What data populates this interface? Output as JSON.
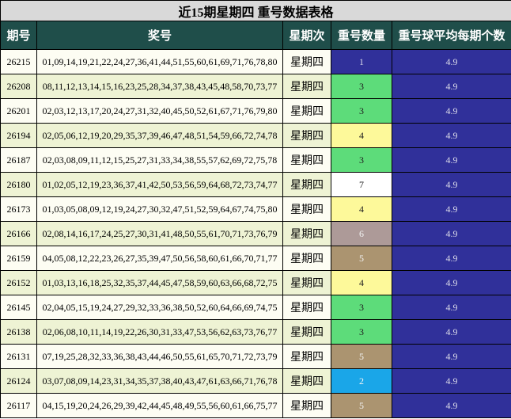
{
  "title": "近15期星期四 重号数据表格",
  "headers": [
    "期号",
    "奖号",
    "星期次",
    "重号数量",
    "重号球平均每期个数"
  ],
  "rows": [
    {
      "id": "26215",
      "numbers": "01,09,14,19,21,22,24,27,36,41,44,51,55,60,61,69,71,76,78,80",
      "week": "星期四",
      "count": "1",
      "count_color": "#30309a",
      "count_text_color": "#d8d8e8",
      "avg": "4.9"
    },
    {
      "id": "26208",
      "numbers": "08,11,12,13,14,15,16,23,25,28,34,37,38,43,45,48,58,70,73,77",
      "week": "星期四",
      "count": "3",
      "count_color": "#5ddc7a",
      "count_text_color": "#222222",
      "avg": "4.9"
    },
    {
      "id": "26201",
      "numbers": "02,03,12,13,17,20,24,27,31,32,40,45,50,52,61,67,71,76,79,80",
      "week": "星期四",
      "count": "3",
      "count_color": "#5ddc7a",
      "count_text_color": "#222222",
      "avg": "4.9"
    },
    {
      "id": "26194",
      "numbers": "02,05,06,12,19,20,29,35,37,39,46,47,48,51,54,59,66,72,74,78",
      "week": "星期四",
      "count": "4",
      "count_color": "#fdf99a",
      "count_text_color": "#222222",
      "avg": "4.9"
    },
    {
      "id": "26187",
      "numbers": "02,03,08,09,11,12,15,25,27,31,33,34,38,55,57,62,69,72,75,78",
      "week": "星期四",
      "count": "3",
      "count_color": "#5ddc7a",
      "count_text_color": "#222222",
      "avg": "4.9"
    },
    {
      "id": "26180",
      "numbers": "01,02,05,12,19,23,36,37,41,42,50,53,56,59,64,68,72,73,74,77",
      "week": "星期四",
      "count": "7",
      "count_color": "#ffffff",
      "count_text_color": "#222222",
      "avg": "4.9"
    },
    {
      "id": "26173",
      "numbers": "01,03,05,08,09,12,19,24,27,30,32,47,51,52,59,64,67,74,75,80",
      "week": "星期四",
      "count": "4",
      "count_color": "#fdf99a",
      "count_text_color": "#222222",
      "avg": "4.9"
    },
    {
      "id": "26166",
      "numbers": "02,08,14,16,17,24,25,27,30,31,41,48,50,55,61,70,71,73,76,79",
      "week": "星期四",
      "count": "6",
      "count_color": "#ad9a98",
      "count_text_color": "#f2f2f2",
      "avg": "4.9"
    },
    {
      "id": "26159",
      "numbers": "04,05,08,12,22,23,26,27,35,39,47,50,56,58,60,61,66,70,71,77",
      "week": "星期四",
      "count": "5",
      "count_color": "#ab9470",
      "count_text_color": "#f2f2f2",
      "avg": "4.9"
    },
    {
      "id": "26152",
      "numbers": "01,03,13,16,18,25,32,35,37,44,45,47,58,59,60,63,66,68,72,75",
      "week": "星期四",
      "count": "4",
      "count_color": "#fdf99a",
      "count_text_color": "#222222",
      "avg": "4.9"
    },
    {
      "id": "26145",
      "numbers": "02,04,05,15,19,24,27,29,32,33,36,38,50,52,60,64,66,69,74,75",
      "week": "星期四",
      "count": "3",
      "count_color": "#5ddc7a",
      "count_text_color": "#222222",
      "avg": "4.9"
    },
    {
      "id": "26138",
      "numbers": "02,06,08,10,11,14,19,22,26,30,31,33,47,53,56,62,63,73,76,77",
      "week": "星期四",
      "count": "3",
      "count_color": "#5ddc7a",
      "count_text_color": "#222222",
      "avg": "4.9"
    },
    {
      "id": "26131",
      "numbers": "07,19,25,28,32,33,36,38,43,44,46,50,55,61,65,70,71,72,73,79",
      "week": "星期四",
      "count": "5",
      "count_color": "#ab9470",
      "count_text_color": "#f2f2f2",
      "avg": "4.9"
    },
    {
      "id": "26124",
      "numbers": "03,07,08,09,14,23,31,34,35,37,38,40,43,47,61,63,66,71,76,78",
      "week": "星期四",
      "count": "2",
      "count_color": "#1aa6e8",
      "count_text_color": "#f2f2f2",
      "avg": "4.9"
    },
    {
      "id": "26117",
      "numbers": "04,15,19,20,24,26,29,39,42,44,45,48,49,55,56,60,61,66,75,77",
      "week": "星期四",
      "count": "5",
      "count_color": "#ab9470",
      "count_text_color": "#f2f2f2",
      "avg": "4.9"
    }
  ]
}
